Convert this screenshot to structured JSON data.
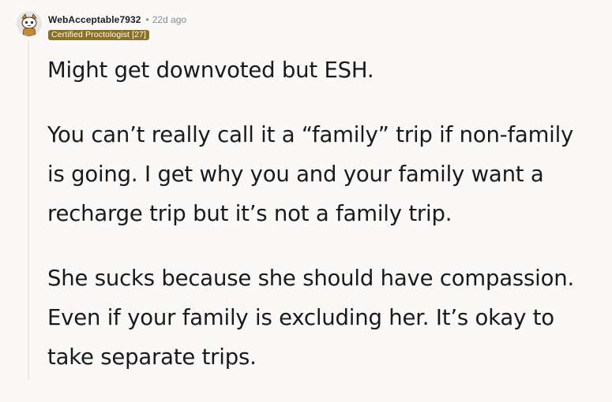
{
  "comment": {
    "author": "WebAcceptable7932",
    "separator": "•",
    "timestamp": "22d ago",
    "flair": "Certified Proctologist [27]",
    "avatar_icon": "snoo-avatar-icon",
    "paragraphs": [
      "Might get downvoted but ESH.",
      "You can’t really call it a “family” trip if non-family\nis going.  I get why you and your family want a\nrecharge trip but it’s not a family trip.",
      "She sucks because she should have compassion.\nEven if your family is excluding her.  It’s okay to\ntake separate trips."
    ]
  },
  "colors": {
    "background": "#faf9f8",
    "flair_bg": "#8a7020",
    "meta_text": "#878a8c",
    "thread_line": "#ecebea"
  }
}
